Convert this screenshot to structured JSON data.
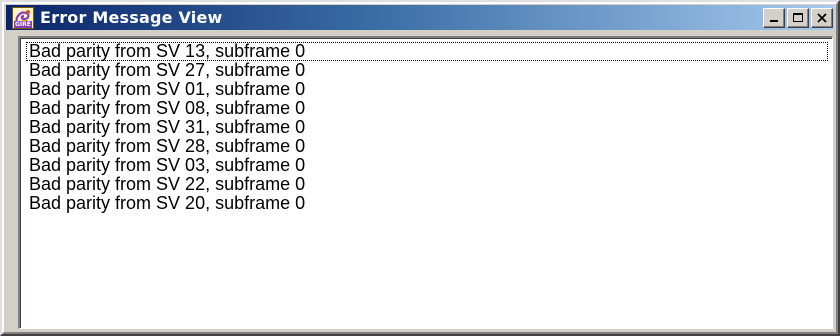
{
  "window": {
    "title": "Error Message View",
    "icon_name": "gire-app-icon",
    "icon_caption": "GIRE",
    "title_gradient": [
      "#0a246a",
      "#a6caf0"
    ]
  },
  "title_buttons": {
    "minimize": "minimize-icon",
    "maximize": "maximize-icon",
    "close": "close-icon"
  },
  "messages": [
    "Bad parity from SV 13, subframe 0",
    "Bad parity from SV 27, subframe 0",
    "Bad parity from SV 01, subframe 0",
    "Bad parity from SV 08, subframe 0",
    "Bad parity from SV 31, subframe 0",
    "Bad parity from SV 28, subframe 0",
    "Bad parity from SV 03, subframe 0",
    "Bad parity from SV 22, subframe 0",
    "Bad parity from SV 20, subframe 0"
  ]
}
